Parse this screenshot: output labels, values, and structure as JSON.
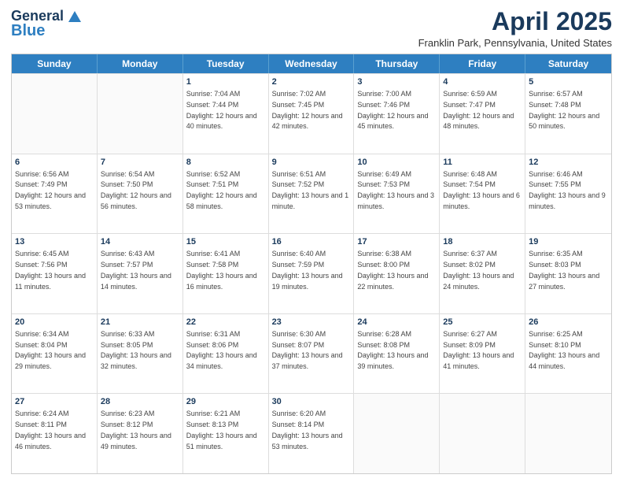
{
  "header": {
    "logo_line1": "General",
    "logo_line2": "Blue",
    "month": "April 2025",
    "subtitle": "Franklin Park, Pennsylvania, United States"
  },
  "days_of_week": [
    "Sunday",
    "Monday",
    "Tuesday",
    "Wednesday",
    "Thursday",
    "Friday",
    "Saturday"
  ],
  "weeks": [
    [
      {
        "day": "",
        "sunrise": "",
        "sunset": "",
        "daylight": ""
      },
      {
        "day": "",
        "sunrise": "",
        "sunset": "",
        "daylight": ""
      },
      {
        "day": "1",
        "sunrise": "Sunrise: 7:04 AM",
        "sunset": "Sunset: 7:44 PM",
        "daylight": "Daylight: 12 hours and 40 minutes."
      },
      {
        "day": "2",
        "sunrise": "Sunrise: 7:02 AM",
        "sunset": "Sunset: 7:45 PM",
        "daylight": "Daylight: 12 hours and 42 minutes."
      },
      {
        "day": "3",
        "sunrise": "Sunrise: 7:00 AM",
        "sunset": "Sunset: 7:46 PM",
        "daylight": "Daylight: 12 hours and 45 minutes."
      },
      {
        "day": "4",
        "sunrise": "Sunrise: 6:59 AM",
        "sunset": "Sunset: 7:47 PM",
        "daylight": "Daylight: 12 hours and 48 minutes."
      },
      {
        "day": "5",
        "sunrise": "Sunrise: 6:57 AM",
        "sunset": "Sunset: 7:48 PM",
        "daylight": "Daylight: 12 hours and 50 minutes."
      }
    ],
    [
      {
        "day": "6",
        "sunrise": "Sunrise: 6:56 AM",
        "sunset": "Sunset: 7:49 PM",
        "daylight": "Daylight: 12 hours and 53 minutes."
      },
      {
        "day": "7",
        "sunrise": "Sunrise: 6:54 AM",
        "sunset": "Sunset: 7:50 PM",
        "daylight": "Daylight: 12 hours and 56 minutes."
      },
      {
        "day": "8",
        "sunrise": "Sunrise: 6:52 AM",
        "sunset": "Sunset: 7:51 PM",
        "daylight": "Daylight: 12 hours and 58 minutes."
      },
      {
        "day": "9",
        "sunrise": "Sunrise: 6:51 AM",
        "sunset": "Sunset: 7:52 PM",
        "daylight": "Daylight: 13 hours and 1 minute."
      },
      {
        "day": "10",
        "sunrise": "Sunrise: 6:49 AM",
        "sunset": "Sunset: 7:53 PM",
        "daylight": "Daylight: 13 hours and 3 minutes."
      },
      {
        "day": "11",
        "sunrise": "Sunrise: 6:48 AM",
        "sunset": "Sunset: 7:54 PM",
        "daylight": "Daylight: 13 hours and 6 minutes."
      },
      {
        "day": "12",
        "sunrise": "Sunrise: 6:46 AM",
        "sunset": "Sunset: 7:55 PM",
        "daylight": "Daylight: 13 hours and 9 minutes."
      }
    ],
    [
      {
        "day": "13",
        "sunrise": "Sunrise: 6:45 AM",
        "sunset": "Sunset: 7:56 PM",
        "daylight": "Daylight: 13 hours and 11 minutes."
      },
      {
        "day": "14",
        "sunrise": "Sunrise: 6:43 AM",
        "sunset": "Sunset: 7:57 PM",
        "daylight": "Daylight: 13 hours and 14 minutes."
      },
      {
        "day": "15",
        "sunrise": "Sunrise: 6:41 AM",
        "sunset": "Sunset: 7:58 PM",
        "daylight": "Daylight: 13 hours and 16 minutes."
      },
      {
        "day": "16",
        "sunrise": "Sunrise: 6:40 AM",
        "sunset": "Sunset: 7:59 PM",
        "daylight": "Daylight: 13 hours and 19 minutes."
      },
      {
        "day": "17",
        "sunrise": "Sunrise: 6:38 AM",
        "sunset": "Sunset: 8:00 PM",
        "daylight": "Daylight: 13 hours and 22 minutes."
      },
      {
        "day": "18",
        "sunrise": "Sunrise: 6:37 AM",
        "sunset": "Sunset: 8:02 PM",
        "daylight": "Daylight: 13 hours and 24 minutes."
      },
      {
        "day": "19",
        "sunrise": "Sunrise: 6:35 AM",
        "sunset": "Sunset: 8:03 PM",
        "daylight": "Daylight: 13 hours and 27 minutes."
      }
    ],
    [
      {
        "day": "20",
        "sunrise": "Sunrise: 6:34 AM",
        "sunset": "Sunset: 8:04 PM",
        "daylight": "Daylight: 13 hours and 29 minutes."
      },
      {
        "day": "21",
        "sunrise": "Sunrise: 6:33 AM",
        "sunset": "Sunset: 8:05 PM",
        "daylight": "Daylight: 13 hours and 32 minutes."
      },
      {
        "day": "22",
        "sunrise": "Sunrise: 6:31 AM",
        "sunset": "Sunset: 8:06 PM",
        "daylight": "Daylight: 13 hours and 34 minutes."
      },
      {
        "day": "23",
        "sunrise": "Sunrise: 6:30 AM",
        "sunset": "Sunset: 8:07 PM",
        "daylight": "Daylight: 13 hours and 37 minutes."
      },
      {
        "day": "24",
        "sunrise": "Sunrise: 6:28 AM",
        "sunset": "Sunset: 8:08 PM",
        "daylight": "Daylight: 13 hours and 39 minutes."
      },
      {
        "day": "25",
        "sunrise": "Sunrise: 6:27 AM",
        "sunset": "Sunset: 8:09 PM",
        "daylight": "Daylight: 13 hours and 41 minutes."
      },
      {
        "day": "26",
        "sunrise": "Sunrise: 6:25 AM",
        "sunset": "Sunset: 8:10 PM",
        "daylight": "Daylight: 13 hours and 44 minutes."
      }
    ],
    [
      {
        "day": "27",
        "sunrise": "Sunrise: 6:24 AM",
        "sunset": "Sunset: 8:11 PM",
        "daylight": "Daylight: 13 hours and 46 minutes."
      },
      {
        "day": "28",
        "sunrise": "Sunrise: 6:23 AM",
        "sunset": "Sunset: 8:12 PM",
        "daylight": "Daylight: 13 hours and 49 minutes."
      },
      {
        "day": "29",
        "sunrise": "Sunrise: 6:21 AM",
        "sunset": "Sunset: 8:13 PM",
        "daylight": "Daylight: 13 hours and 51 minutes."
      },
      {
        "day": "30",
        "sunrise": "Sunrise: 6:20 AM",
        "sunset": "Sunset: 8:14 PM",
        "daylight": "Daylight: 13 hours and 53 minutes."
      },
      {
        "day": "",
        "sunrise": "",
        "sunset": "",
        "daylight": ""
      },
      {
        "day": "",
        "sunrise": "",
        "sunset": "",
        "daylight": ""
      },
      {
        "day": "",
        "sunrise": "",
        "sunset": "",
        "daylight": ""
      }
    ]
  ]
}
